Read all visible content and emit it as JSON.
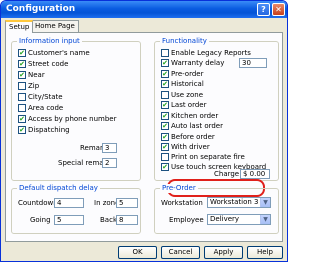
{
  "window": {
    "title": "Configuration",
    "help_glyph": "?",
    "close_glyph": "✕"
  },
  "tabs": [
    "Setup",
    "Home Page"
  ],
  "information_input": {
    "title": "Information input",
    "items": [
      {
        "label": "Customer's name",
        "checked": true
      },
      {
        "label": "Street code",
        "checked": true
      },
      {
        "label": "Near",
        "checked": true
      },
      {
        "label": "Zip",
        "checked": false
      },
      {
        "label": "City/State",
        "checked": false
      },
      {
        "label": "Area code",
        "checked": false
      },
      {
        "label": "Access by phone number",
        "checked": true
      },
      {
        "label": "Dispatching",
        "checked": true
      }
    ],
    "remark_label": "Remark",
    "remark_value": "3",
    "special_remark_label": "Special remark",
    "special_remark_value": "2"
  },
  "functionality": {
    "title": "Functionality",
    "items": [
      {
        "label": "Enable Legacy Reports",
        "checked": false
      },
      {
        "label": "Warranty delay",
        "checked": true
      },
      {
        "label": "Pre-order",
        "checked": true
      },
      {
        "label": "Historical",
        "checked": true
      },
      {
        "label": "Use zone",
        "checked": false
      },
      {
        "label": "Last order",
        "checked": true
      },
      {
        "label": "Kitchen order",
        "checked": true
      },
      {
        "label": "Auto last order",
        "checked": true
      },
      {
        "label": "Before order",
        "checked": true
      },
      {
        "label": "With driver",
        "checked": true
      },
      {
        "label": "Print on separate fire",
        "checked": false
      },
      {
        "label": "Use touch screen keyboard",
        "checked": true
      }
    ],
    "warranty_value": "30",
    "charge_label": "Charge",
    "charge_value": "$ 0.00"
  },
  "dispatch_delay": {
    "title": "Default dispatch delay",
    "countdown_label": "Countdown",
    "countdown_value": "4",
    "in_zone_label": "In zone",
    "in_zone_value": "5",
    "going_label": "Going",
    "going_value": "5",
    "back_label": "Back",
    "back_value": "8"
  },
  "pre_order": {
    "title": "Pre-Order",
    "workstation_label": "Workstation",
    "workstation_value": "Workstation 3",
    "employee_label": "Employee",
    "employee_value": "Delivery"
  },
  "buttons": {
    "ok": "OK",
    "cancel": "Cancel",
    "apply": "Apply",
    "help": "Help"
  },
  "check_glyph": "✔",
  "dropdown_glyph": "▼"
}
